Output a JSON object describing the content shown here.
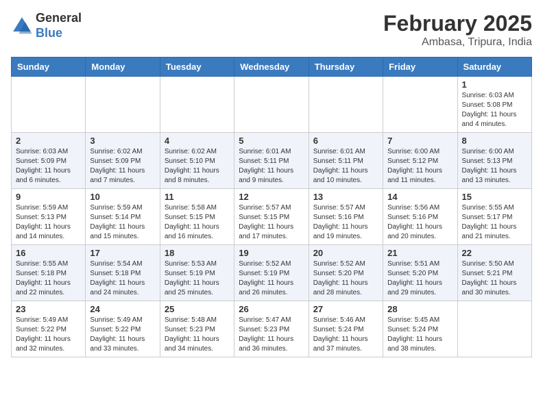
{
  "header": {
    "logo_general": "General",
    "logo_blue": "Blue",
    "month": "February 2025",
    "location": "Ambasa, Tripura, India"
  },
  "days_of_week": [
    "Sunday",
    "Monday",
    "Tuesday",
    "Wednesday",
    "Thursday",
    "Friday",
    "Saturday"
  ],
  "weeks": [
    [
      {
        "day": "",
        "info": ""
      },
      {
        "day": "",
        "info": ""
      },
      {
        "day": "",
        "info": ""
      },
      {
        "day": "",
        "info": ""
      },
      {
        "day": "",
        "info": ""
      },
      {
        "day": "",
        "info": ""
      },
      {
        "day": "1",
        "info": "Sunrise: 6:03 AM\nSunset: 5:08 PM\nDaylight: 11 hours and 4 minutes."
      }
    ],
    [
      {
        "day": "2",
        "info": "Sunrise: 6:03 AM\nSunset: 5:09 PM\nDaylight: 11 hours and 6 minutes."
      },
      {
        "day": "3",
        "info": "Sunrise: 6:02 AM\nSunset: 5:09 PM\nDaylight: 11 hours and 7 minutes."
      },
      {
        "day": "4",
        "info": "Sunrise: 6:02 AM\nSunset: 5:10 PM\nDaylight: 11 hours and 8 minutes."
      },
      {
        "day": "5",
        "info": "Sunrise: 6:01 AM\nSunset: 5:11 PM\nDaylight: 11 hours and 9 minutes."
      },
      {
        "day": "6",
        "info": "Sunrise: 6:01 AM\nSunset: 5:11 PM\nDaylight: 11 hours and 10 minutes."
      },
      {
        "day": "7",
        "info": "Sunrise: 6:00 AM\nSunset: 5:12 PM\nDaylight: 11 hours and 11 minutes."
      },
      {
        "day": "8",
        "info": "Sunrise: 6:00 AM\nSunset: 5:13 PM\nDaylight: 11 hours and 13 minutes."
      }
    ],
    [
      {
        "day": "9",
        "info": "Sunrise: 5:59 AM\nSunset: 5:13 PM\nDaylight: 11 hours and 14 minutes."
      },
      {
        "day": "10",
        "info": "Sunrise: 5:59 AM\nSunset: 5:14 PM\nDaylight: 11 hours and 15 minutes."
      },
      {
        "day": "11",
        "info": "Sunrise: 5:58 AM\nSunset: 5:15 PM\nDaylight: 11 hours and 16 minutes."
      },
      {
        "day": "12",
        "info": "Sunrise: 5:57 AM\nSunset: 5:15 PM\nDaylight: 11 hours and 17 minutes."
      },
      {
        "day": "13",
        "info": "Sunrise: 5:57 AM\nSunset: 5:16 PM\nDaylight: 11 hours and 19 minutes."
      },
      {
        "day": "14",
        "info": "Sunrise: 5:56 AM\nSunset: 5:16 PM\nDaylight: 11 hours and 20 minutes."
      },
      {
        "day": "15",
        "info": "Sunrise: 5:55 AM\nSunset: 5:17 PM\nDaylight: 11 hours and 21 minutes."
      }
    ],
    [
      {
        "day": "16",
        "info": "Sunrise: 5:55 AM\nSunset: 5:18 PM\nDaylight: 11 hours and 22 minutes."
      },
      {
        "day": "17",
        "info": "Sunrise: 5:54 AM\nSunset: 5:18 PM\nDaylight: 11 hours and 24 minutes."
      },
      {
        "day": "18",
        "info": "Sunrise: 5:53 AM\nSunset: 5:19 PM\nDaylight: 11 hours and 25 minutes."
      },
      {
        "day": "19",
        "info": "Sunrise: 5:52 AM\nSunset: 5:19 PM\nDaylight: 11 hours and 26 minutes."
      },
      {
        "day": "20",
        "info": "Sunrise: 5:52 AM\nSunset: 5:20 PM\nDaylight: 11 hours and 28 minutes."
      },
      {
        "day": "21",
        "info": "Sunrise: 5:51 AM\nSunset: 5:20 PM\nDaylight: 11 hours and 29 minutes."
      },
      {
        "day": "22",
        "info": "Sunrise: 5:50 AM\nSunset: 5:21 PM\nDaylight: 11 hours and 30 minutes."
      }
    ],
    [
      {
        "day": "23",
        "info": "Sunrise: 5:49 AM\nSunset: 5:22 PM\nDaylight: 11 hours and 32 minutes."
      },
      {
        "day": "24",
        "info": "Sunrise: 5:49 AM\nSunset: 5:22 PM\nDaylight: 11 hours and 33 minutes."
      },
      {
        "day": "25",
        "info": "Sunrise: 5:48 AM\nSunset: 5:23 PM\nDaylight: 11 hours and 34 minutes."
      },
      {
        "day": "26",
        "info": "Sunrise: 5:47 AM\nSunset: 5:23 PM\nDaylight: 11 hours and 36 minutes."
      },
      {
        "day": "27",
        "info": "Sunrise: 5:46 AM\nSunset: 5:24 PM\nDaylight: 11 hours and 37 minutes."
      },
      {
        "day": "28",
        "info": "Sunrise: 5:45 AM\nSunset: 5:24 PM\nDaylight: 11 hours and 38 minutes."
      },
      {
        "day": "",
        "info": ""
      }
    ]
  ]
}
